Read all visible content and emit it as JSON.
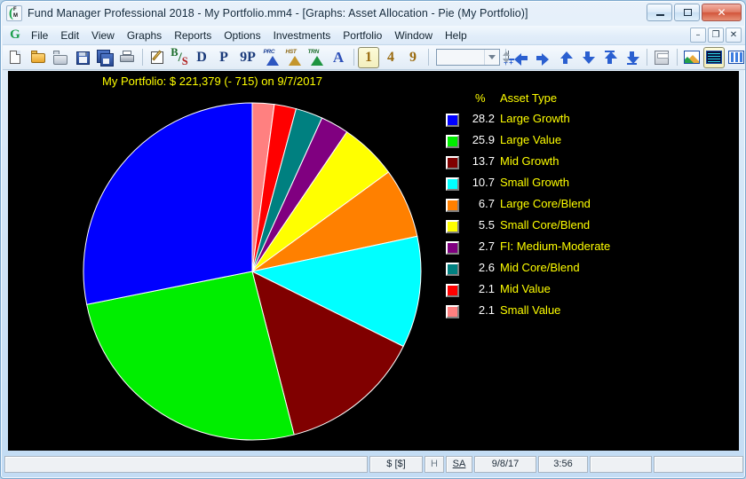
{
  "window": {
    "title": "Fund Manager Professional 2018 - My Portfolio.mm4 - [Graphs: Asset Allocation - Pie (My Portfolio)]",
    "icon": "fund-manager-icon",
    "minimize_label": "",
    "maximize_label": "",
    "close_label": "✕"
  },
  "menubar": {
    "logo": "G",
    "items": [
      {
        "label": "File"
      },
      {
        "label": "Edit"
      },
      {
        "label": "View"
      },
      {
        "label": "Graphs"
      },
      {
        "label": "Reports"
      },
      {
        "label": "Options"
      },
      {
        "label": "Investments"
      },
      {
        "label": "Portfolio"
      },
      {
        "label": "Window"
      },
      {
        "label": "Help"
      }
    ],
    "mdi_buttons": [
      {
        "name": "mdi-minimize",
        "glyph": "–"
      },
      {
        "name": "mdi-restore",
        "glyph": "❐"
      },
      {
        "name": "mdi-close",
        "glyph": "✕"
      }
    ]
  },
  "toolbar": {
    "buttons": [
      {
        "name": "new-file-icon",
        "label": ""
      },
      {
        "name": "open-folder-icon",
        "label": ""
      },
      {
        "name": "open-readonly-icon",
        "label": ""
      },
      {
        "name": "save-icon",
        "label": ""
      },
      {
        "name": "save-as-icon",
        "label": ""
      },
      {
        "name": "print-icon",
        "label": ""
      },
      {
        "name": "edit-note-icon",
        "label": ""
      },
      {
        "name": "percent-icon",
        "label": ""
      },
      {
        "name": "d-button",
        "label": "D"
      },
      {
        "name": "p-button",
        "label": "P"
      },
      {
        "name": "9p-button",
        "label": "9P"
      },
      {
        "name": "prc-house-icon",
        "label": "PRC"
      },
      {
        "name": "hst-house-icon",
        "label": "HST"
      },
      {
        "name": "trn-house-icon",
        "label": "TRN"
      },
      {
        "name": "a-button",
        "label": "A"
      },
      {
        "name": "pane-1-button",
        "label": "1"
      },
      {
        "name": "pane-4-button",
        "label": "4"
      },
      {
        "name": "pane-9-button",
        "label": "9"
      }
    ],
    "combo_value": "",
    "pane_selected": "1",
    "nav_buttons": [
      {
        "name": "nav-back-icon"
      },
      {
        "name": "nav-forward-icon"
      },
      {
        "name": "nav-up-icon"
      },
      {
        "name": "nav-down-icon"
      },
      {
        "name": "nav-first-icon"
      },
      {
        "name": "nav-last-icon"
      }
    ],
    "right_buttons": [
      {
        "name": "calculator-icon"
      },
      {
        "name": "graph-view-icon"
      },
      {
        "name": "grid-view-icon"
      },
      {
        "name": "columns-view-icon"
      },
      {
        "name": "copy-report-icon"
      }
    ]
  },
  "chart": {
    "title": "My Portfolio: $ 221,379 (- 715) on 9/7/2017",
    "title_color": "#ffff00",
    "background_color": "#000000",
    "legend_header": {
      "percent": "%",
      "type": "Asset Type"
    }
  },
  "chart_data": {
    "type": "pie",
    "title": "My Portfolio: $ 221,379 (- 715) on 9/7/2017",
    "value_label": "$ 221,379",
    "change_label": "(- 715)",
    "date_label": "9/7/2017",
    "units": "percent",
    "legend_position": "right",
    "start_angle_deg": 0,
    "direction": "clockwise",
    "labels": [
      "Large Growth",
      "Large Value",
      "Mid Growth",
      "Small Growth",
      "Large Core/Blend",
      "Small Core/Blend",
      "FI: Medium-Moderate",
      "Mid Core/Blend",
      "Mid Value",
      "Small Value"
    ],
    "values": [
      28.2,
      25.9,
      13.7,
      10.7,
      6.7,
      5.5,
      2.7,
      2.6,
      2.1,
      2.1
    ],
    "colors": [
      "#0000ff",
      "#00ee00",
      "#800000",
      "#00ffff",
      "#ff8000",
      "#ffff00",
      "#800080",
      "#008080",
      "#ff0000",
      "#ff8080"
    ],
    "slice_draw_order": [
      {
        "label": "Small Value",
        "value": 2.1,
        "color": "#ff8080"
      },
      {
        "label": "Mid Value",
        "value": 2.1,
        "color": "#ff0000"
      },
      {
        "label": "Mid Core/Blend",
        "value": 2.6,
        "color": "#008080"
      },
      {
        "label": "FI: Medium-Moderate",
        "value": 2.7,
        "color": "#800080"
      },
      {
        "label": "Small Core/Blend",
        "value": 5.5,
        "color": "#ffff00"
      },
      {
        "label": "Large Core/Blend",
        "value": 6.7,
        "color": "#ff8000"
      },
      {
        "label": "Small Growth",
        "value": 10.7,
        "color": "#00ffff"
      },
      {
        "label": "Mid Growth",
        "value": 13.7,
        "color": "#800000"
      },
      {
        "label": "Large Value",
        "value": 25.9,
        "color": "#00ee00"
      },
      {
        "label": "Large Growth",
        "value": 28.2,
        "color": "#0000ff"
      }
    ]
  },
  "legend": {
    "rows": [
      {
        "pct": "28.2",
        "label": "Large Growth",
        "color": "#0000ff"
      },
      {
        "pct": "25.9",
        "label": "Large Value",
        "color": "#00ee00"
      },
      {
        "pct": "13.7",
        "label": "Mid Growth",
        "color": "#800000"
      },
      {
        "pct": "10.7",
        "label": "Small Growth",
        "color": "#00ffff"
      },
      {
        "pct": "6.7",
        "label": "Large Core/Blend",
        "color": "#ff8000"
      },
      {
        "pct": "5.5",
        "label": "Small Core/Blend",
        "color": "#ffff00"
      },
      {
        "pct": "2.7",
        "label": "FI: Medium-Moderate",
        "color": "#800080"
      },
      {
        "pct": "2.6",
        "label": "Mid Core/Blend",
        "color": "#008080"
      },
      {
        "pct": "2.1",
        "label": "Mid Value",
        "color": "#ff0000"
      },
      {
        "pct": "2.1",
        "label": "Small Value",
        "color": "#ff8080"
      }
    ]
  },
  "statusbar": {
    "message": "",
    "currency": "$ [$]",
    "h_flag": "H",
    "sa_flag": "SA",
    "date": "9/8/17",
    "time": "3:56",
    "extra1": "",
    "extra2": ""
  }
}
